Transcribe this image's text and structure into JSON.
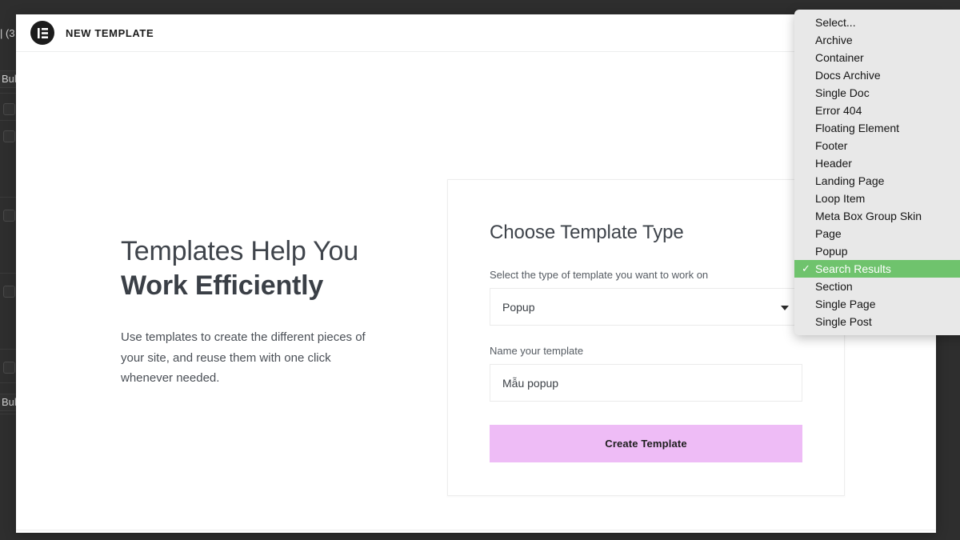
{
  "background": {
    "counts_text": "| (3",
    "bulk_label_top": "Bulk",
    "bulk_label_bottom": "Bulk"
  },
  "modal": {
    "logo_icon": "elementor-logo-icon",
    "title": "NEW TEMPLATE"
  },
  "hero": {
    "heading_line1": "Templates Help You",
    "heading_line2": "Work Efficiently",
    "paragraph": "Use templates to create the different pieces of your site, and reuse them with one click whenever needed."
  },
  "card": {
    "title": "Choose Template Type",
    "type_label": "Select the type of template you want to work on",
    "type_value": "Popup",
    "type_arrow_icon": "chevron-down-icon",
    "name_label": "Name your template",
    "name_value": "Mẫu popup",
    "name_placeholder": "Name your template",
    "submit_label": "Create Template",
    "submit_color": "#eebcf6"
  },
  "dropdown": {
    "highlight_color": "#6fc36d",
    "background_color": "#e8e8e8",
    "check_glyph": "✓",
    "selected_index": 14,
    "items": [
      {
        "label": "Select..."
      },
      {
        "label": "Archive"
      },
      {
        "label": "Container"
      },
      {
        "label": "Docs Archive"
      },
      {
        "label": "Single Doc"
      },
      {
        "label": "Error 404"
      },
      {
        "label": "Floating Element"
      },
      {
        "label": "Footer"
      },
      {
        "label": "Header"
      },
      {
        "label": "Landing Page"
      },
      {
        "label": "Loop Item"
      },
      {
        "label": "Meta Box Group Skin"
      },
      {
        "label": "Page"
      },
      {
        "label": "Popup"
      },
      {
        "label": "Search Results"
      },
      {
        "label": "Section"
      },
      {
        "label": "Single Page"
      },
      {
        "label": "Single Post"
      }
    ]
  }
}
